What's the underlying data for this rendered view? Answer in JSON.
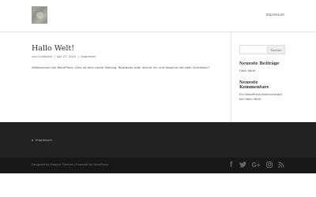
{
  "header": {
    "nav": {
      "impressum": "Impressum"
    }
  },
  "post": {
    "title": "Hallo Welt!",
    "meta": {
      "prefix": "von",
      "author": "Lichtblick",
      "separator": "|",
      "date": "Apr 27, 2021",
      "category": "Allgemein"
    },
    "body": "Willkommen bei WordPress. Dies ist dein erster Beitrag. Bearbeite oder lösche ihn und beginne mit dem Schreiben!"
  },
  "sidebar": {
    "search": {
      "placeholder": "",
      "button": "Suchen"
    },
    "recent_posts": {
      "title": "Neueste Beiträge",
      "items": [
        "Hallo Welt!"
      ]
    },
    "recent_comments": {
      "title": "Neueste Kommentare",
      "text": "Ein WordPress-Kommentator bei Hallo Welt!"
    }
  },
  "footer": {
    "menu": [
      "Impressum"
    ],
    "credits": {
      "designed_by": "Designed by",
      "theme": "Elegant Themes",
      "powered_by": "| Powered by",
      "cms": "WordPress"
    },
    "social_icons": [
      "facebook-icon",
      "twitter-icon",
      "google-plus-icon",
      "instagram-icon",
      "rss-icon"
    ]
  }
}
